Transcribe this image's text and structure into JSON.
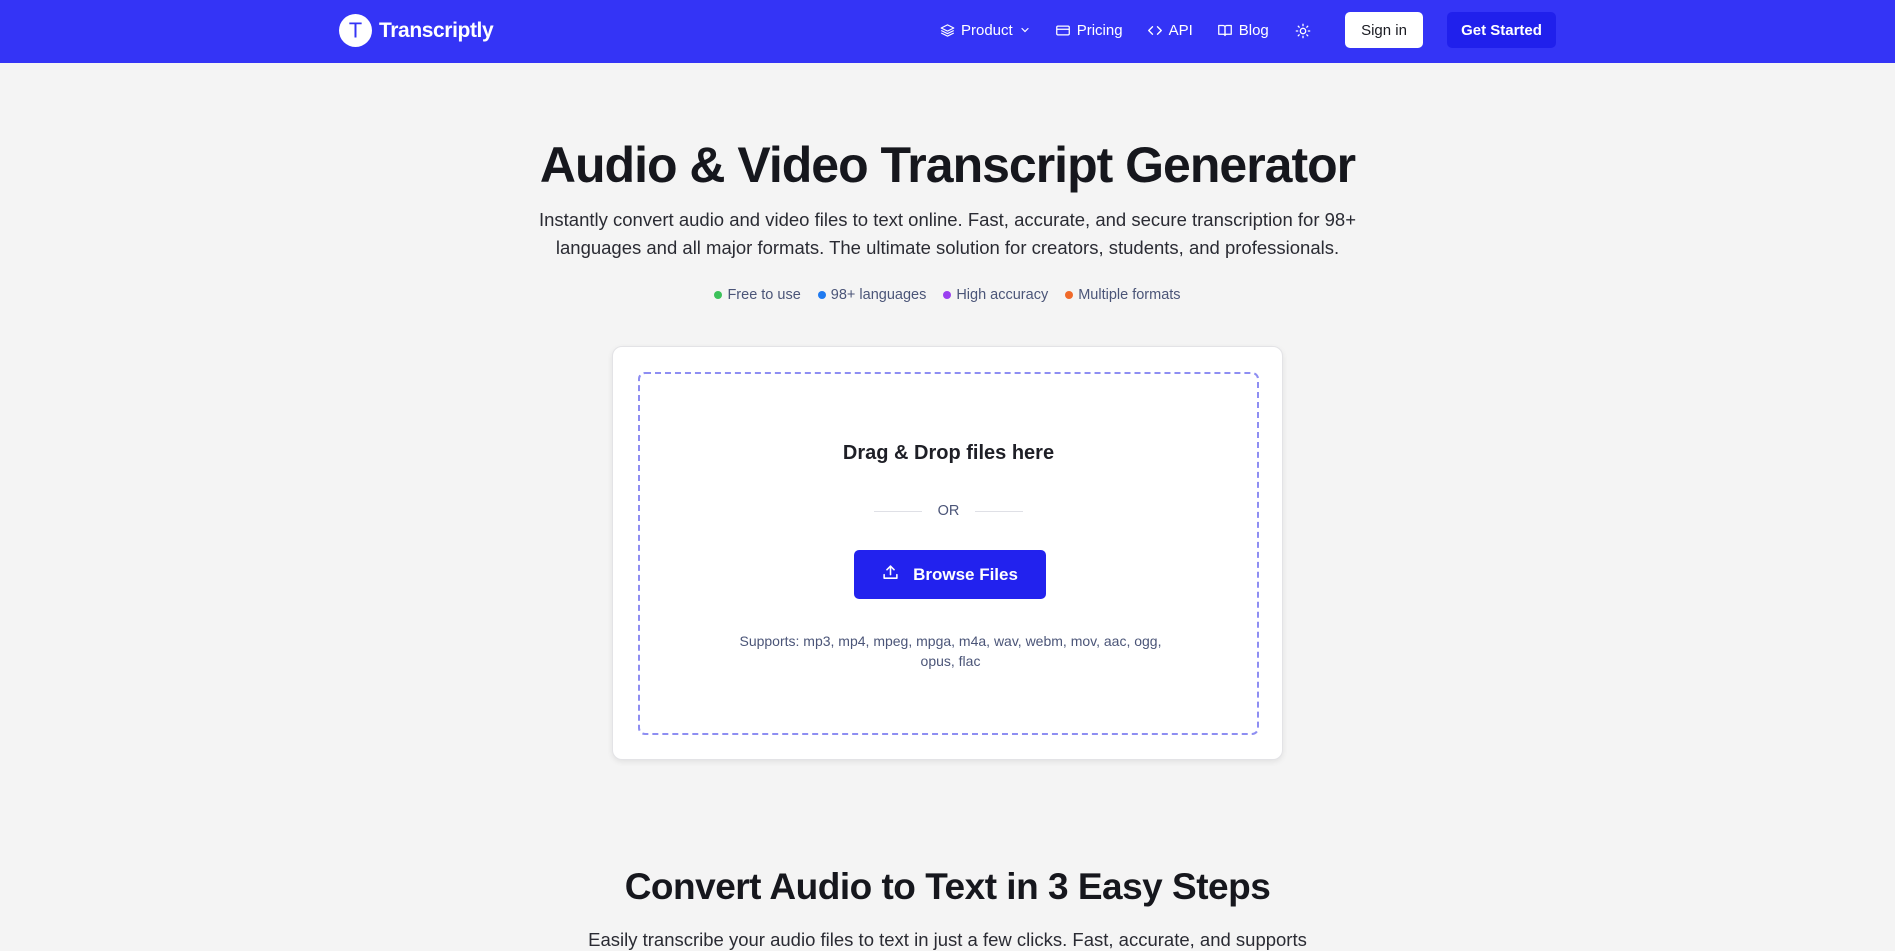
{
  "nav": {
    "brand_letter": "T",
    "brand_name": "Transcriptly",
    "links": [
      {
        "label": "Product",
        "icon": "layers-icon",
        "has_dropdown": true
      },
      {
        "label": "Pricing",
        "icon": "credit-card-icon"
      },
      {
        "label": "API",
        "icon": "code-icon"
      },
      {
        "label": "Blog",
        "icon": "book-icon"
      }
    ],
    "theme_icon": "sun-icon",
    "sign_in_label": "Sign in",
    "get_started_label": "Get Started"
  },
  "hero": {
    "title": "Audio & Video Transcript Generator",
    "subtitle": "Instantly convert audio and video files to text online. Fast, accurate, and secure transcription for 98+ languages and all major formats. The ultimate solution for creators, students, and professionals.",
    "features": [
      {
        "label": "Free to use",
        "color": "#3cc15a"
      },
      {
        "label": "98+ languages",
        "color": "#1f7af0"
      },
      {
        "label": "High accuracy",
        "color": "#9a3ff0"
      },
      {
        "label": "Multiple formats",
        "color": "#f06a2a"
      }
    ]
  },
  "upload": {
    "drop_title": "Drag & Drop files here",
    "or_label": "OR",
    "browse_label": "Browse Files",
    "browse_icon": "upload-icon",
    "supports": "Supports: mp3, mp4, mpeg, mpga, m4a, wav, webm, mov, aac, ogg, opus, flac"
  },
  "steps": {
    "title": "Convert Audio to Text in 3 Easy Steps",
    "subtitle": "Easily transcribe your audio files to text in just a few clicks. Fast, accurate, and supports"
  },
  "colors": {
    "nav_bg": "#3434f6",
    "accent": "#2222ee",
    "page_bg": "#f4f4f4",
    "dropzone_border": "#8e8ef2"
  }
}
